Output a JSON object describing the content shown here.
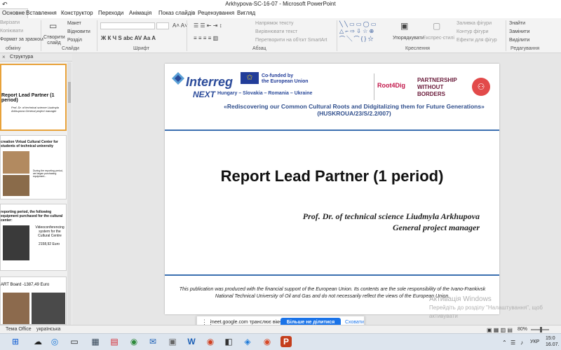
{
  "window": {
    "title": "Arkhypova-SC-16-07 - Microsoft PowerPoint"
  },
  "ribbon_tabs": {
    "home": "Основне",
    "insert": "Вставлення",
    "design": "Конструктор",
    "transitions": "Переходи",
    "animations": "Анімація",
    "slideshow": "Показ слайдів",
    "review": "Рецензування",
    "view": "Вигляд"
  },
  "ribbon": {
    "cut": "Вирізати",
    "copy": "Копіювати",
    "format_painter": "Формат за зразком",
    "clipboard_group": "обміну",
    "new_slide": "Створити слайд",
    "layout": "Макет",
    "reset": "Відновити",
    "section": "Розділ",
    "slides_group": "Слайди",
    "font_group": "Шрифт",
    "text_direction": "Напрямок тексту",
    "align_text": "Вирівнювати текст",
    "smartart": "Перетворити на об'єкт SmartArt",
    "paragraph_group": "Абзац",
    "arrange": "Упорядкувати",
    "quick_styles": "Експрес-стилі",
    "drawing_group": "Креслення",
    "shape_fill": "Заливка фігури",
    "shape_outline": "Контур фігури",
    "shape_effects": "Ефекти для фігур",
    "find": "Знайти",
    "replace": "Замінити",
    "select": "Виділити",
    "editing_group": "Редагування"
  },
  "left_panel": {
    "tab_structure": "Структура",
    "thumbs": [
      {
        "title": "Report Lead Partner (1 period)",
        "sub": "Prof. Dr. of technical science Liudmyla Arkhupova General project manager"
      },
      {
        "title": "creation Virtual Cultural Center for students of technical university",
        "sub": "During the reporting period, we began purchasing equipment..."
      },
      {
        "title": "reporting period, the following equipment purchased for the cultural center:",
        "cap": "Videoconferencing system for the Cultural Centre",
        "price": "2158,92 Euro"
      },
      {
        "title": "ART Board -1387,49 Euro"
      }
    ]
  },
  "slide": {
    "interreg": "Interreg",
    "next": "NEXT",
    "countries": "Hungary – Slovakia – Romania – Ukraine",
    "eu_text_line1": "Co-funded by",
    "eu_text_line2": "the European Union",
    "root4dig": "Root4Dig",
    "pwb_line1": "PARTNERSHIP",
    "pwb_line2": "WITHOUT",
    "pwb_line3": "BORDERS",
    "subtitle": "«Rediscovering our Common Cultural Roots and Didgitalizing them for Future Generations» (HUSKROUA/23/S/2.2/007)",
    "title": "Report Lead Partner (1 period)",
    "author": "Prof. Dr. of technical science Liudmyla Arkhupova",
    "role": "General project manager",
    "footer": "This publication was produced with the financial support of the European Union. Its contents are the sole responsibility of the Ivano-Frankivsk National Technical University of Oil and Gas and do not necessarily reflect the views of the European Union."
  },
  "share_bar": {
    "text": "meet.google.com транслює вікно.",
    "stop_button": "Більше не ділитися",
    "cancel": "Сховати"
  },
  "watermark": {
    "line1": "Активація Windows",
    "line2": "Перейдіть до розділу \"Налаштування\", щоб активувати"
  },
  "statusbar": {
    "theme": "Тема Office",
    "language": "українська",
    "zoom": "80%"
  },
  "taskbar": {
    "tray_lang": "УКР",
    "time": "15:0",
    "date": "16.07."
  }
}
